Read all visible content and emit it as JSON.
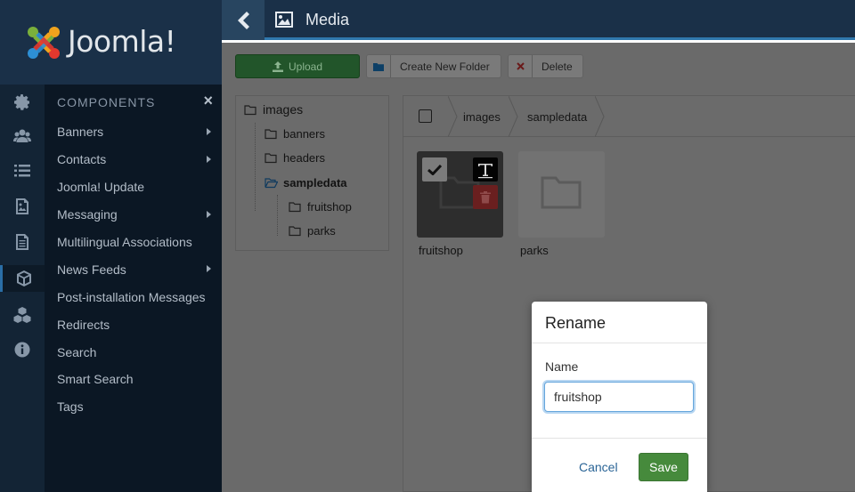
{
  "brand": {
    "name": "Joomla!"
  },
  "header": {
    "title": "Media"
  },
  "menu": {
    "title": "COMPONENTS",
    "close_label": "×",
    "items": [
      {
        "label": "Banners",
        "has_submenu": true
      },
      {
        "label": "Contacts",
        "has_submenu": true
      },
      {
        "label": "Joomla! Update",
        "has_submenu": false
      },
      {
        "label": "Messaging",
        "has_submenu": true
      },
      {
        "label": "Multilingual Associations",
        "has_submenu": false
      },
      {
        "label": "News Feeds",
        "has_submenu": true
      },
      {
        "label": "Post-installation Messages",
        "has_submenu": false
      },
      {
        "label": "Redirects",
        "has_submenu": false
      },
      {
        "label": "Search",
        "has_submenu": false
      },
      {
        "label": "Smart Search",
        "has_submenu": false
      },
      {
        "label": "Tags",
        "has_submenu": false
      }
    ]
  },
  "rail_icons": [
    "gear-icon",
    "users-icon",
    "list-icon",
    "image-icon",
    "document-icon",
    "cube-icon",
    "cubes-icon",
    "info-icon"
  ],
  "toolbar": {
    "upload_label": "Upload",
    "new_folder_label": "Create New Folder",
    "delete_label": "Delete"
  },
  "tree": {
    "root": "images",
    "children": [
      "banners",
      "headers",
      "sampledata"
    ],
    "sampledata_children": [
      "fruitshop",
      "parks"
    ]
  },
  "breadcrumb": [
    "images",
    "sampledata"
  ],
  "files": [
    {
      "name": "fruitshop",
      "selected": true
    },
    {
      "name": "parks",
      "selected": false
    }
  ],
  "modal": {
    "title": "Rename",
    "field_label": "Name",
    "field_value": "fruitshop",
    "cancel_label": "Cancel",
    "save_label": "Save"
  },
  "colors": {
    "header_bg": "#1a3048",
    "accent_blue": "#2f78ad",
    "upload_green": "#22552a",
    "save_green": "#468a3c",
    "link_blue": "#2a6496"
  }
}
